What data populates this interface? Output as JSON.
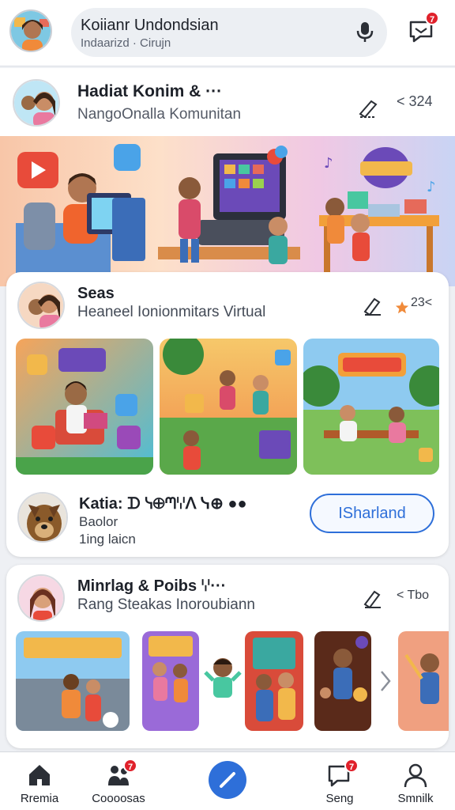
{
  "header": {
    "title": "Koiianr Undondsian",
    "subtitle": "Indaarizd · Cirujn",
    "chat_badge": "7"
  },
  "group": {
    "title": "Hadiat Konim & ···",
    "subtitle": "NangoOnalla Komunitan",
    "count": "< 324"
  },
  "post": {
    "title": "Seas",
    "subtitle": "Heaneel Ionionmitars Virtual",
    "count": "23<",
    "author_name": "Katia: ᗪ ᓭ⊕ᘉꗷᐱ ᓭ⊕ ●●",
    "author_line2": "Baolor",
    "author_line3": "1ing laicn",
    "join_label": "ISharland"
  },
  "post2": {
    "title": "Minrlag & Poibs ꗷ···",
    "subtitle": "Rang Steakas Inoroubiann",
    "count": "< Tbo"
  },
  "nav": {
    "items": [
      {
        "label": "Rremia",
        "icon": "home-icon"
      },
      {
        "label": "Coooosas",
        "icon": "people-icon",
        "badge": "7"
      },
      {
        "label": "",
        "icon": "compose-icon"
      },
      {
        "label": "Seng",
        "icon": "chat-icon",
        "badge": "7"
      },
      {
        "label": "Smnilk",
        "icon": "profile-icon"
      }
    ]
  },
  "colors": {
    "accent": "#2e6fd9",
    "badge": "#e0212b",
    "background": "#eef0f4"
  }
}
